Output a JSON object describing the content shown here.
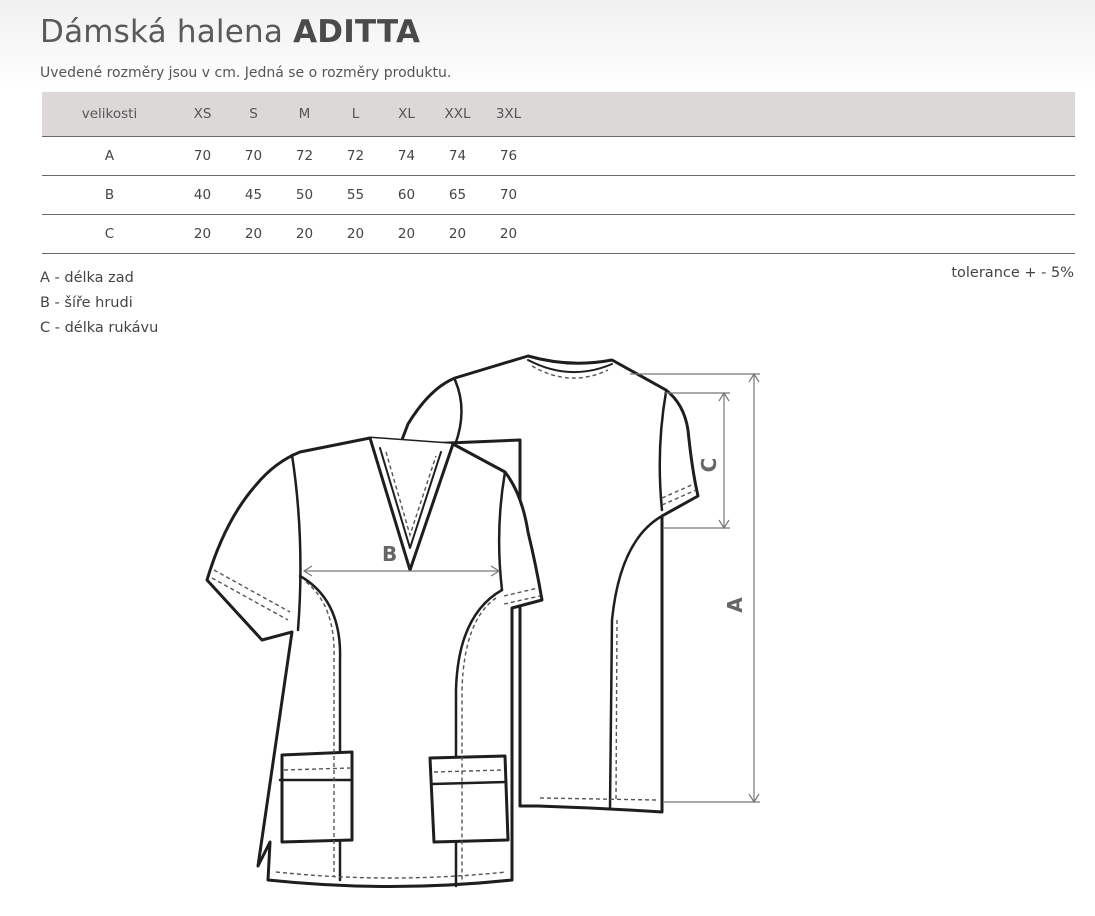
{
  "product": {
    "title_prefix": "Dámská halena",
    "title_name": "ADITTA",
    "subtitle": "Uvedené rozměry jsou v cm. Jedná se o rozměry produktu."
  },
  "size_table": {
    "header": [
      "velikosti",
      "XS",
      "S",
      "M",
      "L",
      "XL",
      "XXL",
      "3XL"
    ],
    "rows": [
      {
        "label": "A",
        "values": [
          "70",
          "70",
          "72",
          "72",
          "74",
          "74",
          "76"
        ]
      },
      {
        "label": "B",
        "values": [
          "40",
          "45",
          "50",
          "55",
          "60",
          "65",
          "70"
        ]
      },
      {
        "label": "C",
        "values": [
          "20",
          "20",
          "20",
          "20",
          "20",
          "20",
          "20"
        ]
      }
    ]
  },
  "legend": [
    "A - délka zad",
    "B - šíře hrudi",
    "C - délka rukávu"
  ],
  "tolerance": "tolerance + - 5%",
  "diagram_labels": {
    "a": "A",
    "b": "B",
    "c": "C"
  }
}
